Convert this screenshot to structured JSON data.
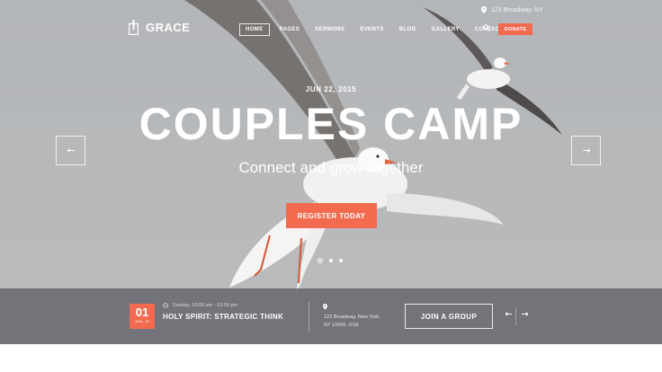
{
  "topbar": {
    "address": "123 Broadway, NY"
  },
  "logo": {
    "name": "GRACE"
  },
  "nav": [
    {
      "label": "HOME",
      "active": true
    },
    {
      "label": "PAGES"
    },
    {
      "label": "SERMONS"
    },
    {
      "label": "EVENTS"
    },
    {
      "label": "BLOG"
    },
    {
      "label": "GALLERY"
    },
    {
      "label": "CONTACTS"
    }
  ],
  "donate_label": "DONATE",
  "hero": {
    "date": "JUN 22, 2015",
    "title": "COUPLES CAMP",
    "subtitle": "Connect and grow together",
    "cta": "REGISTER TODAY",
    "slide_count": 3,
    "active_slide": 1
  },
  "event": {
    "day": "01",
    "month": "JUN, 15",
    "time": "Sunday, 10:00 am - 12:00 pm",
    "title": "HOLY SPIRIT: STRATEGIC THINK",
    "address_line1": "123 Broadway, New York,",
    "address_line2": "NY 10006, USA",
    "join_label": "JOIN A GROUP"
  },
  "colors": {
    "accent": "#f26b4f",
    "hero_bg": "#b5b7b9",
    "event_bar": "#6c6c72"
  },
  "icons": [
    "logo-cross-icon",
    "location-pin-icon",
    "search-icon",
    "arrow-left-icon",
    "arrow-right-icon",
    "clock-icon"
  ]
}
